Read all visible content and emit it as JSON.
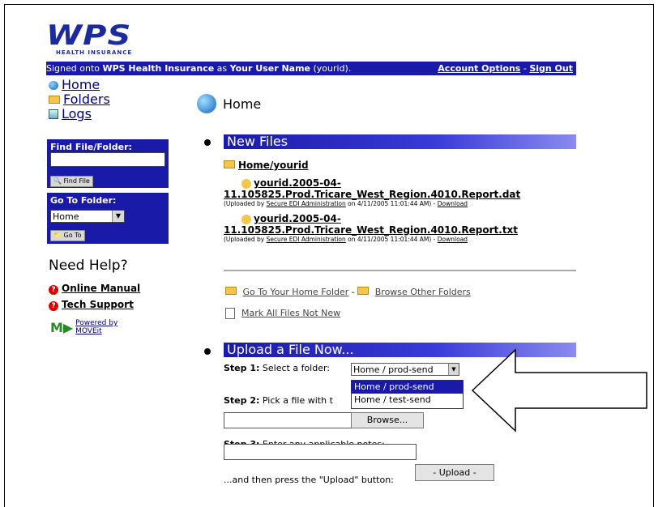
{
  "brand": {
    "logo": "WPS",
    "logo_sub": "HEALTH INSURANCE"
  },
  "topbar": {
    "prefix": "Signed onto ",
    "org": "WPS Health Insurance",
    "mid": " as ",
    "user": "Your User Name",
    "userid": " (yourid).",
    "account": "Account Options",
    "sep": " - ",
    "signout": "Sign Out"
  },
  "nav": {
    "home": "Home",
    "folders": "Folders",
    "logs": "Logs"
  },
  "find": {
    "title": "Find File/Folder:",
    "button": "Find File"
  },
  "goto": {
    "title": "Go To Folder:",
    "selected": "Home",
    "button": "Go To"
  },
  "help": {
    "title": "Need Help?",
    "manual": "Online Manual",
    "support": "Tech Support"
  },
  "powered": {
    "line1": "Powered by",
    "line2": "MOVEit"
  },
  "page": {
    "title": "Home"
  },
  "newfiles": {
    "title": "New Files",
    "folder": "Home/yourid",
    "files": [
      {
        "name1": "yourid.2005-04-",
        "name2": "11.105825.Prod.Tricare_West_Region.4010.Report.dat",
        "meta_prefix": "(Uploaded by ",
        "uploader": "Secure EDI Administration",
        "meta_suffix": " on 4/11/2005 11:01:44 AM) - ",
        "download": "Download"
      },
      {
        "name1": "yourid.2005-04-",
        "name2": "11.105825.Prod.Tricare_West_Region.4010.Report.txt",
        "meta_prefix": "(Uploaded by ",
        "uploader": "Secure EDI Administration",
        "meta_suffix": " on 4/11/2005 11:01:44 AM) - ",
        "download": "Download"
      }
    ],
    "goto_home": "Go To Your Home Folder",
    "dash": " - ",
    "browse_other": "Browse Other Folders",
    "mark_all": "Mark All Files Not New"
  },
  "upload": {
    "title": "Upload a File Now...",
    "step1_label": "Step 1:",
    "step1_text": " Select a folder:",
    "selected": "Home / prod-send",
    "options": [
      "Home / prod-send",
      "Home / test-send"
    ],
    "step2_label": "Step 2:",
    "step2_text": " Pick a file with t",
    "browse": "Browse...",
    "step3_label": "Step 3:",
    "step3_text": " Enter any applicable notes:",
    "press_text": "...and then press the \"Upload\" button:",
    "upload_btn": "- Upload -"
  }
}
